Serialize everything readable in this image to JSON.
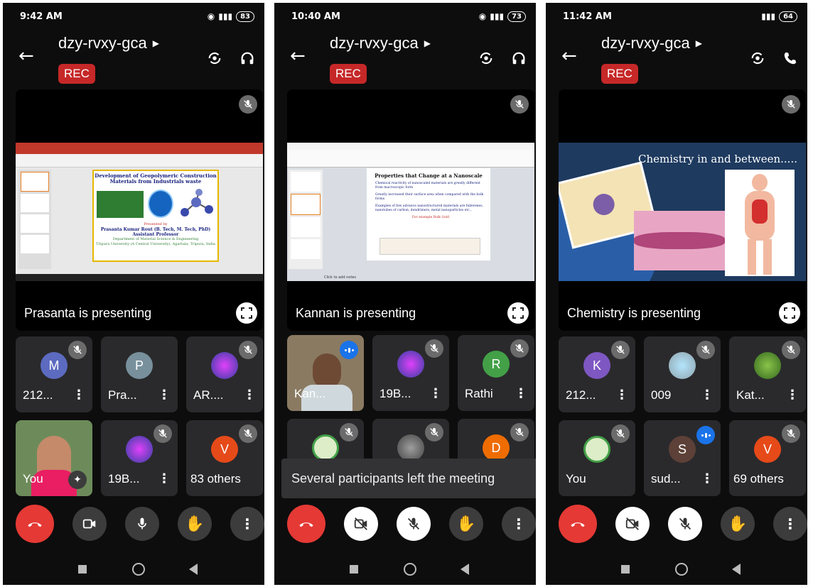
{
  "meeting_code": "dzy-rvxy-gca",
  "rec_label": "REC",
  "screens": [
    {
      "time": "9:42 AM",
      "battery": "83",
      "presenter_label": "Prasanta is presenting",
      "slide": {
        "title_line1": "Development of Geopolymeric Construction",
        "title_line2": "Materials from Industrials waste",
        "presented_by": "Presented by",
        "author": "Prasanta Kumar Rout (B. Tech, M. Tech, PhD)",
        "role": "Assistant Professor",
        "dept": "Department of Material Science & Engineering",
        "univ": "Tripura University (A Central University), Agartala, Tripura, India"
      },
      "tiles": [
        {
          "avatar": "M",
          "name": "212..."
        },
        {
          "avatar": "P",
          "name": "Pra..."
        },
        {
          "avatar": "",
          "name": "AR...."
        },
        {
          "avatar": "",
          "name": "You"
        },
        {
          "avatar": "",
          "name": "19B..."
        },
        {
          "avatar": "V",
          "name": "83 others"
        }
      ]
    },
    {
      "time": "10:40 AM",
      "battery": "73",
      "presenter_label": "Kannan is presenting",
      "slide": {
        "title": "Properties that Change at a Nanoscale",
        "b1": "Chemical reactivity of nanoscaled materials are greatly different from macroscopic form",
        "b2": "Greatly increased their surface area when compared with the bulk forms",
        "b3": "Examples of few advance nanostructured materials are fullerenes, nanotubes of carbon, dendrimers, metal nanoparticles etc.,",
        "example": "For example Bulk Gold",
        "notes": "Click to add notes"
      },
      "tiles": [
        {
          "avatar": "",
          "name": "Kan..."
        },
        {
          "avatar": "",
          "name": "19B..."
        },
        {
          "avatar": "R",
          "name": "Rathi"
        },
        {
          "avatar": "",
          "name": ""
        },
        {
          "avatar": "",
          "name": ""
        },
        {
          "avatar": "D",
          "name": ""
        }
      ],
      "toast": "Several participants left the meeting"
    },
    {
      "time": "11:42 AM",
      "battery": "64",
      "presenter_label": "Chemistry is presenting",
      "slide": {
        "title": "Chemistry in and between....."
      },
      "tiles": [
        {
          "avatar": "K",
          "name": "212..."
        },
        {
          "avatar": "",
          "name": "009"
        },
        {
          "avatar": "",
          "name": "Kat..."
        },
        {
          "avatar": "",
          "name": "You"
        },
        {
          "avatar": "S",
          "name": "sud..."
        },
        {
          "avatar": "V",
          "name": "69 others"
        }
      ]
    }
  ],
  "colors": {
    "rec": "#c62828",
    "end_call": "#e53935",
    "avatar_m": "#5c6bc0",
    "avatar_p": "#78909c",
    "avatar_v": "#e64a19",
    "avatar_r": "#43a047",
    "avatar_d": "#ef6c00",
    "avatar_k": "#7e57c2",
    "avatar_s": "#5d4037"
  },
  "icons": {
    "back": "arrow-left-icon",
    "camera_flip": "camera-switch-icon",
    "audio": "headphones-icon",
    "mute": "mic-off-icon",
    "fullscreen": "fullscreen-icon"
  }
}
